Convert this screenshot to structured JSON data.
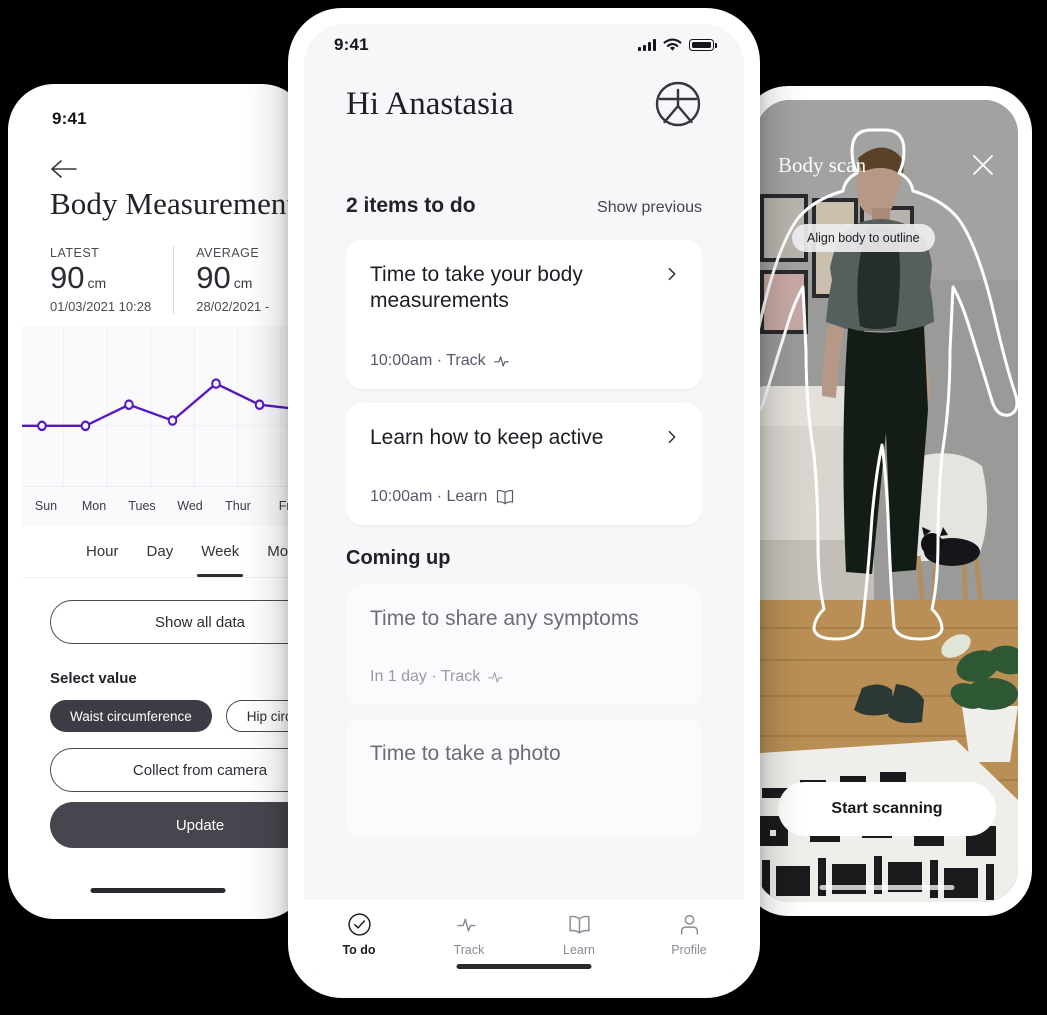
{
  "colors": {
    "accent_purple": "#5417c4",
    "dark_button": "#46464e",
    "selected_pill": "#3c3c44",
    "page_background": "#000000",
    "card_background": "#ffffff",
    "screen_background": "#f7f7fa"
  },
  "left_phone": {
    "status_bar": {
      "time": "9:41"
    },
    "back_icon": "back-arrow-icon",
    "title": "Body Measurements",
    "stats": [
      {
        "label": "LATEST",
        "value": "90",
        "unit": "cm",
        "date": "01/03/2021 10:28"
      },
      {
        "label": "AVERAGE",
        "value": "90",
        "unit": "cm",
        "date": "28/02/2021 -"
      }
    ],
    "chart_x_labels": [
      "Sun",
      "Mon",
      "Tues",
      "Wed",
      "Thur",
      "Fri"
    ],
    "range_tabs": [
      {
        "label": "Hour",
        "selected": false
      },
      {
        "label": "Day",
        "selected": false
      },
      {
        "label": "Week",
        "selected": true
      },
      {
        "label": "Month",
        "selected": false
      }
    ],
    "show_all_data": "Show all data",
    "select_value_label": "Select value",
    "value_pills": [
      {
        "label": "Waist circumference",
        "selected": true
      },
      {
        "label": "Hip circumference",
        "selected": false
      }
    ],
    "collect_from_camera": "Collect from camera",
    "update_button": "Update"
  },
  "center_phone": {
    "status_bar": {
      "time": "9:41"
    },
    "greeting": "Hi Anastasia",
    "logo_icon": "brand-body-logo-icon",
    "todo_count": "2 items to do",
    "show_previous": "Show previous",
    "todo_cards": [
      {
        "title": "Time to take your body measurements",
        "time": "10:00am",
        "category": "Track",
        "icon": "pulse-icon"
      },
      {
        "title": "Learn how to keep active",
        "time": "10:00am",
        "category": "Learn",
        "icon": "book-icon"
      }
    ],
    "coming_up_heading": "Coming up",
    "coming_up_cards": [
      {
        "title": "Time to share any symptoms",
        "time": "In 1 day",
        "category": "Track",
        "icon": "pulse-icon"
      },
      {
        "title": "Time to take a photo",
        "time": "",
        "category": "",
        "icon": ""
      }
    ],
    "tabs": [
      {
        "label": "To do",
        "icon": "check-circle-icon",
        "active": true
      },
      {
        "label": "Track",
        "icon": "pulse-icon",
        "active": false
      },
      {
        "label": "Learn",
        "icon": "book-icon",
        "active": false
      },
      {
        "label": "Profile",
        "icon": "person-icon",
        "active": false
      }
    ]
  },
  "right_phone": {
    "title": "Body scan",
    "close_icon": "close-icon",
    "hint": "Align body to outline",
    "start_button": "Start scanning"
  },
  "chart_data": {
    "type": "line",
    "title": "Waist circumference",
    "xlabel": "",
    "ylabel": "cm",
    "categories": [
      "Sun",
      "Mon",
      "Tues",
      "Wed",
      "Thur",
      "Fri"
    ],
    "values": [
      90,
      90,
      92,
      90.5,
      94,
      92
    ],
    "ylim": [
      86,
      97
    ],
    "grid": true,
    "legend": "none",
    "series": [
      {
        "name": "Waist circumference",
        "values": [
          90,
          90,
          92,
          90.5,
          94,
          92
        ],
        "color": "#5417c4"
      }
    ]
  }
}
